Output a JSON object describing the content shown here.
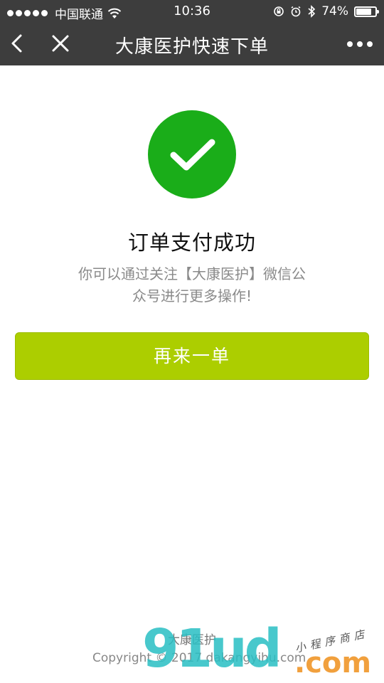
{
  "status_bar": {
    "carrier": "中国联通",
    "time": "10:36",
    "battery": "74%",
    "battery_level": 0.74,
    "icons": [
      "signal-dots-icon",
      "wifi-icon",
      "orientation-lock-icon",
      "alarm-icon",
      "bluetooth-icon",
      "battery-icon"
    ]
  },
  "nav": {
    "title": "大康医护快速下单",
    "icons": [
      "back-icon",
      "close-icon",
      "more-icon"
    ]
  },
  "result": {
    "icon": "check-icon",
    "icon_color": "#1aad19",
    "title": "订单支付成功",
    "desc_line1": "你可以通过关注【大康医护】微信公",
    "desc_line2": "众号进行更多操作!"
  },
  "actions": {
    "again_label": "再来一单",
    "again_color": "#acce00"
  },
  "footer": {
    "brand": "大康医护",
    "copyright": "Copyright © 2017 dakangyihu.com"
  },
  "watermark": {
    "main": "91ud",
    "suffix": ".com",
    "tagline": "小程序商店"
  }
}
